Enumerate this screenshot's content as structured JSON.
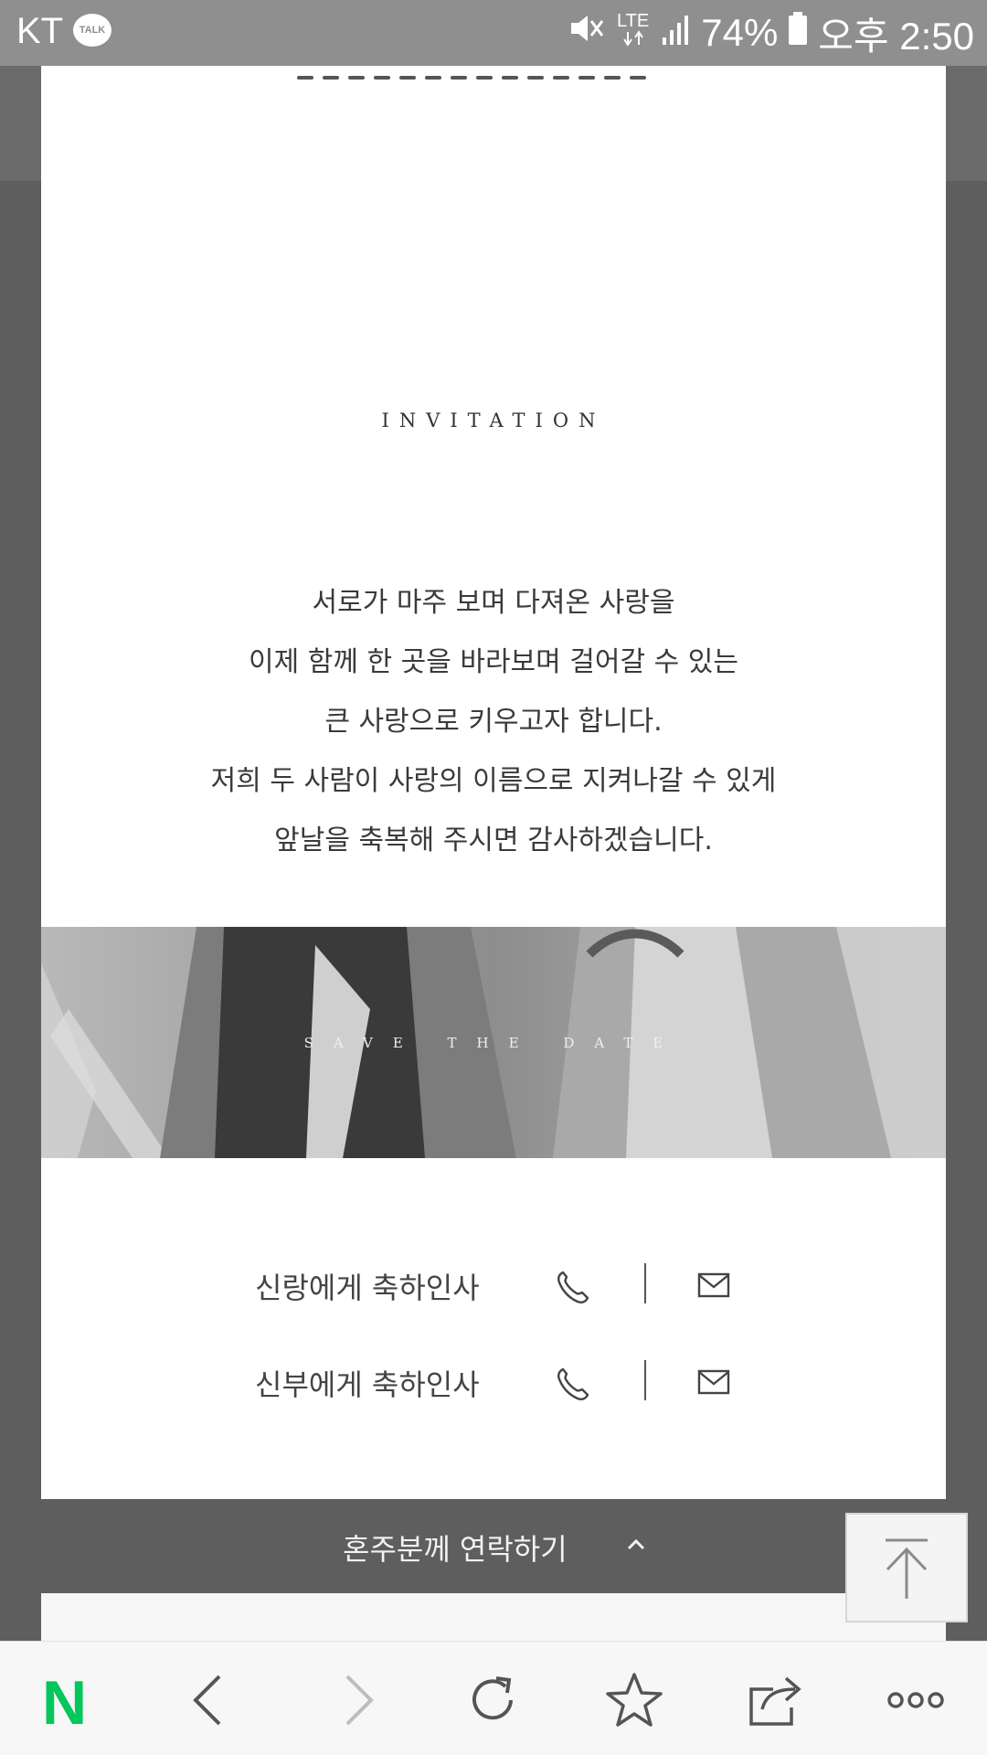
{
  "status_bar": {
    "carrier": "KT",
    "talk_badge": "TALK",
    "network": "LTE",
    "battery": "74%",
    "time": "오후 2:50",
    "icons": [
      "kakaotalk-icon",
      "mute-icon",
      "lte-icon",
      "signal-icon",
      "battery-icon"
    ]
  },
  "invitation": {
    "title": "INVITATION",
    "lines": [
      "서로가 마주 보며 다져온 사랑을",
      "이제 함께 한 곳을 바라보며 걸어갈 수 있는",
      "큰 사랑으로 키우고자 합니다.",
      "저희 두 사람이 사랑의 이름으로 지켜나갈 수 있게",
      "앞날을 축복해 주시면 감사하겠습니다."
    ]
  },
  "photo_banner": {
    "text": "SAVE THE DATE"
  },
  "greetings": [
    {
      "label": "신랑에게 축하인사",
      "icons": [
        "phone-icon",
        "mail-icon"
      ]
    },
    {
      "label": "신부에게 축하인사",
      "icons": [
        "phone-icon",
        "mail-icon"
      ]
    }
  ],
  "contact_bar": {
    "label": "혼주분께 연락하기",
    "icon": "chevron-up-icon"
  },
  "scroll_top": {
    "icon": "arrow-up-to-top-icon"
  },
  "browser_nav": {
    "items": [
      "naver-logo",
      "back-icon",
      "forward-icon",
      "refresh-icon",
      "bookmark-star-icon",
      "share-icon",
      "more-icon"
    ],
    "logo_text": "N"
  },
  "colors": {
    "status_bar": "#8f8f8f",
    "overlay": "#5e5e5e",
    "naver_green": "#03c75a",
    "text": "#3a3a3a"
  }
}
